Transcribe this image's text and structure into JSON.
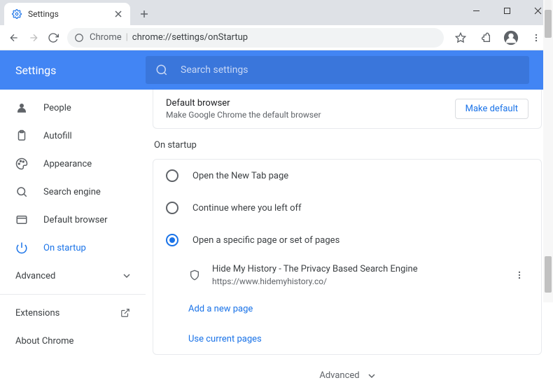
{
  "window": {
    "tab_title": "Settings",
    "minimize": "—",
    "maximize": "☐",
    "close": "✕"
  },
  "toolbar": {
    "url_chip": "Chrome",
    "url_path": "chrome://settings/onStartup"
  },
  "header": {
    "title": "Settings",
    "search_placeholder": "Search settings"
  },
  "sidebar": {
    "items": [
      {
        "label": "People"
      },
      {
        "label": "Autofill"
      },
      {
        "label": "Appearance"
      },
      {
        "label": "Search engine"
      },
      {
        "label": "Default browser"
      },
      {
        "label": "On startup"
      }
    ],
    "advanced": "Advanced",
    "extensions": "Extensions",
    "about": "About Chrome"
  },
  "defbrowser": {
    "title": "Default browser",
    "sub": "Make Google Chrome the default browser",
    "btn": "Make default"
  },
  "startup": {
    "section": "On startup",
    "options": [
      {
        "label": "Open the New Tab page"
      },
      {
        "label": "Continue where you left off"
      },
      {
        "label": "Open a specific page or set of pages"
      }
    ],
    "page": {
      "title": "Hide My History - The Privacy Based Search Engine",
      "url": "https://www.hidemyhistory.co/"
    },
    "add": "Add a new page",
    "use": "Use current pages"
  },
  "footer_adv": "Advanced"
}
